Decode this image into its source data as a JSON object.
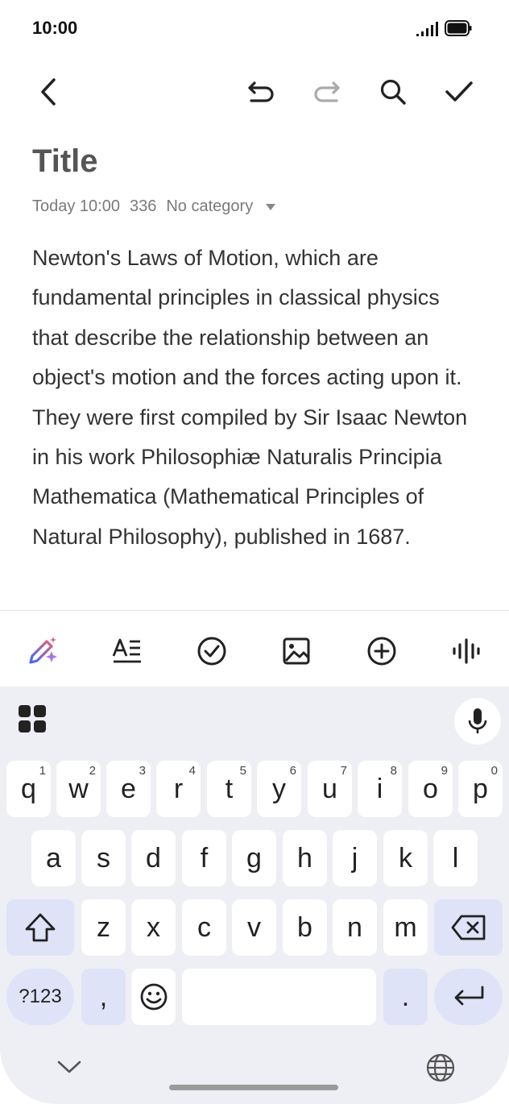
{
  "status": {
    "time": "10:00"
  },
  "note": {
    "title": "Title",
    "date": "Today 10:00",
    "count": "336",
    "category": "No category",
    "body": "Newton's Laws of Motion, which are fundamental principles in classical physics that describe the relationship between an object's motion and the forces acting upon it. They were first compiled by Sir Isaac Newton in his work Philosophiæ Naturalis Principia Mathematica (Mathematical Principles of Natural Philosophy), published in 1687."
  },
  "toolbar_icons": [
    "back-icon",
    "undo-icon",
    "redo-icon",
    "search-icon",
    "check-icon"
  ],
  "format_icons": [
    "ai-pen-icon",
    "text-format-icon",
    "checklist-icon",
    "image-icon",
    "add-icon",
    "audio-icon"
  ],
  "keyboard": {
    "row1": [
      {
        "k": "q",
        "n": "1"
      },
      {
        "k": "w",
        "n": "2"
      },
      {
        "k": "e",
        "n": "3"
      },
      {
        "k": "r",
        "n": "4"
      },
      {
        "k": "t",
        "n": "5"
      },
      {
        "k": "y",
        "n": "6"
      },
      {
        "k": "u",
        "n": "7"
      },
      {
        "k": "i",
        "n": "8"
      },
      {
        "k": "o",
        "n": "9"
      },
      {
        "k": "p",
        "n": "0"
      }
    ],
    "row2": [
      "a",
      "s",
      "d",
      "f",
      "g",
      "h",
      "j",
      "k",
      "l"
    ],
    "row3": [
      "z",
      "x",
      "c",
      "v",
      "b",
      "n",
      "m"
    ],
    "symbols_label": "?123",
    "comma": ",",
    "period": "."
  },
  "colors": {
    "accent": "#dfe3f7",
    "keyboard_bg": "#eeeef5"
  }
}
